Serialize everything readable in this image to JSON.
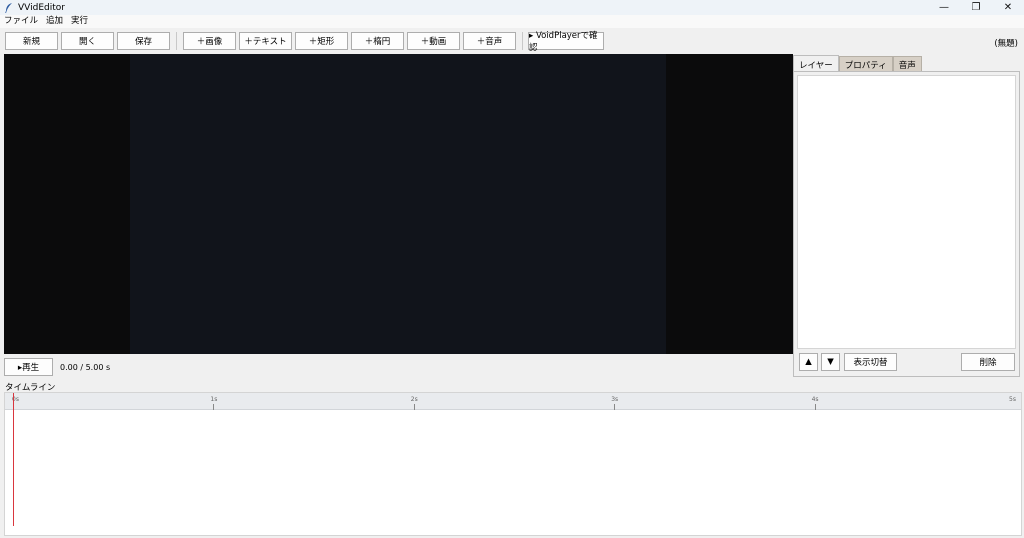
{
  "window": {
    "title": "VVidEditor",
    "controls": [
      "—",
      "❐",
      "✕"
    ]
  },
  "menu": [
    "ファイル",
    "追加",
    "実行"
  ],
  "toolbar": {
    "new": "新規",
    "open": "開く",
    "save": "保存",
    "add_image": "＋画像",
    "add_text": "＋テキスト",
    "add_rect": "＋矩形",
    "add_ellipse": "＋楕円",
    "add_video": "＋動画",
    "add_audio": "＋音声",
    "preview_voidplayer": "▸ VoidPlayerで確認",
    "doc_title": "(無題)"
  },
  "playback": {
    "play_label": "▸再生",
    "time": "0.00 / 5.00 s"
  },
  "side_panel": {
    "tabs": [
      "レイヤー",
      "プロパティ",
      "音声"
    ],
    "active_tab": 0,
    "move_up": "▲",
    "move_down": "▼",
    "toggle_visibility": "表示切替",
    "delete": "削除"
  },
  "timeline": {
    "label": "タイムライン",
    "ticks": [
      "0s",
      "1s",
      "2s",
      "3s",
      "4s",
      "5s"
    ],
    "duration": 5,
    "playhead_time": 0
  },
  "colors": {
    "preview_bg": "#0b0b0c",
    "canvas_bg": "#11141b",
    "playhead": "#d9363e"
  }
}
